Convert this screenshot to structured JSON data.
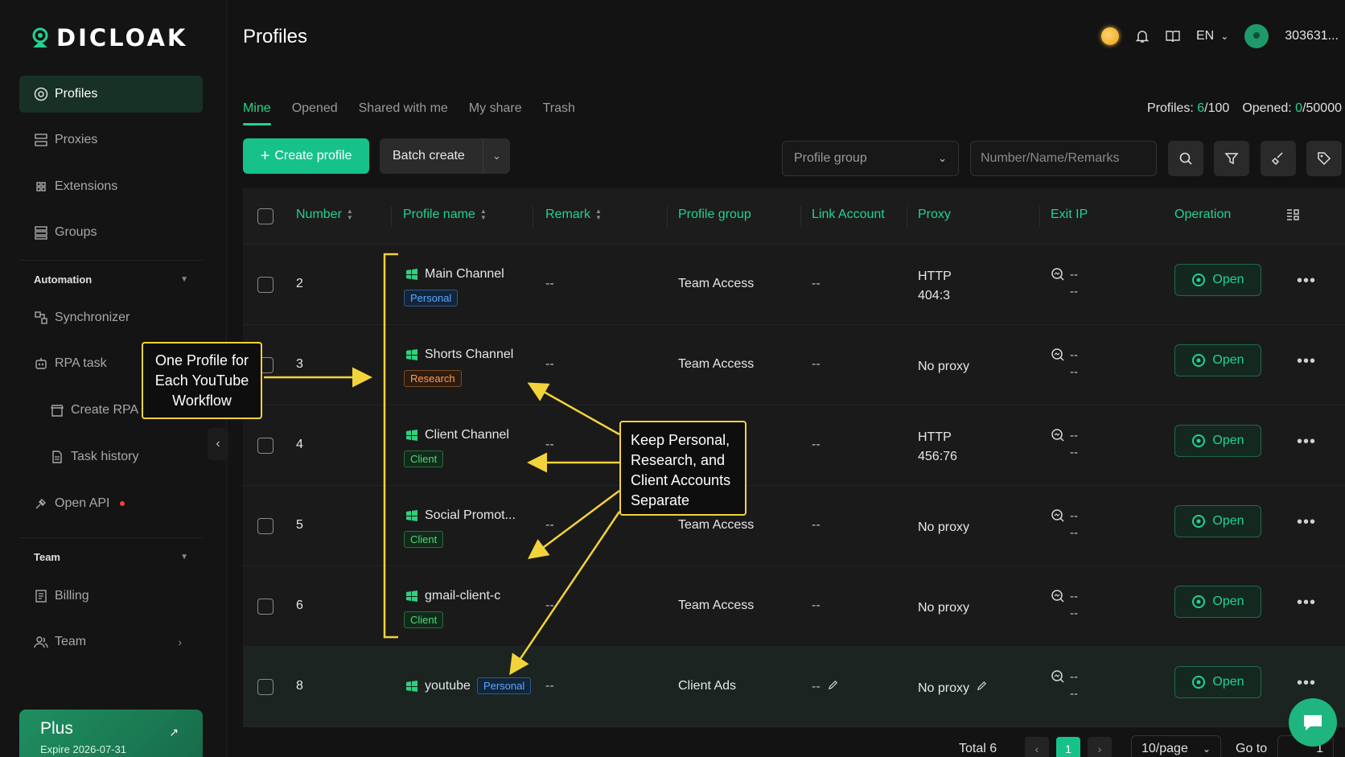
{
  "app": {
    "logo_text": "DICLOAK",
    "page_title": "Profiles",
    "language": "EN",
    "user_id": "303631..."
  },
  "sidebar": {
    "items": [
      {
        "label": "Profiles",
        "icon": "profiles-icon"
      },
      {
        "label": "Proxies",
        "icon": "proxies-icon"
      },
      {
        "label": "Extensions",
        "icon": "extensions-icon"
      },
      {
        "label": "Groups",
        "icon": "groups-icon"
      }
    ],
    "automation_label": "Automation",
    "automation_items": [
      {
        "label": "Synchronizer",
        "icon": "synchronizer-icon"
      },
      {
        "label": "RPA task",
        "icon": "robot-icon"
      },
      {
        "label": "Create RPA",
        "icon": "store-icon"
      },
      {
        "label": "Task history",
        "icon": "document-icon"
      },
      {
        "label": "Open API",
        "icon": "api-icon"
      }
    ],
    "team_label": "Team",
    "team_items": [
      {
        "label": "Billing",
        "icon": "billing-icon"
      },
      {
        "label": "Team",
        "icon": "team-icon"
      }
    ],
    "plan": {
      "name": "Plus",
      "expires": "Expire 2026-07-31"
    }
  },
  "tabs": [
    "Mine",
    "Opened",
    "Shared with me",
    "My share",
    "Trash"
  ],
  "counts": {
    "profiles_label": "Profiles:",
    "profiles_used": "6",
    "profiles_total": "/100",
    "opened_label": "Opened:",
    "opened_used": "0",
    "opened_total": "/50000"
  },
  "toolbar": {
    "create_label": "Create profile",
    "batch_label": "Batch create",
    "group_placeholder": "Profile group",
    "search_placeholder": "Number/Name/Remarks"
  },
  "table": {
    "headers": [
      "Number",
      "Profile name",
      "Remark",
      "Profile group",
      "Link Account",
      "Proxy",
      "Exit IP",
      "Operation"
    ],
    "open_label": "Open",
    "rows": [
      {
        "number": "2",
        "name": "Main Channel",
        "tag": "Personal",
        "tag_type": "personal",
        "remark": "--",
        "group": "Team Access",
        "link": "--",
        "proxy_1": "HTTP",
        "proxy_2": "404:3",
        "exit_1": "--",
        "exit_2": "--"
      },
      {
        "number": "3",
        "name": "Shorts Channel",
        "tag": "Research",
        "tag_type": "research",
        "remark": "--",
        "group": "Team Access",
        "link": "--",
        "proxy_1": "No proxy",
        "proxy_2": "",
        "exit_1": "--",
        "exit_2": "--"
      },
      {
        "number": "4",
        "name": "Client Channel",
        "tag": "Client",
        "tag_type": "client",
        "remark": "--",
        "group": "",
        "link": "--",
        "proxy_1": "HTTP",
        "proxy_2": "456:76",
        "exit_1": "--",
        "exit_2": "--"
      },
      {
        "number": "5",
        "name": "Social Promot...",
        "tag": "Client",
        "tag_type": "client",
        "remark": "--",
        "group": "Team Access",
        "link": "--",
        "proxy_1": "No proxy",
        "proxy_2": "",
        "exit_1": "--",
        "exit_2": "--"
      },
      {
        "number": "6",
        "name": "gmail-client-c",
        "tag": "Client",
        "tag_type": "client",
        "remark": "--",
        "group": "Team Access",
        "link": "--",
        "proxy_1": "No proxy",
        "proxy_2": "",
        "exit_1": "--",
        "exit_2": "--"
      },
      {
        "number": "8",
        "name": "youtube",
        "tag": "Personal",
        "tag_type": "personal",
        "remark": "--",
        "group": "Client Ads",
        "link": "--",
        "proxy_1": "No proxy",
        "proxy_2": "",
        "exit_1": "--",
        "exit_2": "--"
      }
    ]
  },
  "pagination": {
    "total": "Total 6",
    "current_page": "1",
    "page_size": "10/page",
    "goto_label": "Go to",
    "goto_value": "1"
  },
  "annotations": {
    "callout_1": [
      "One Profile for",
      "Each YouTube",
      "Workflow"
    ],
    "callout_2": [
      "Keep Personal,",
      "Research, and",
      "Client Accounts",
      "Separate"
    ]
  },
  "colors": {
    "accent": "#22d38f",
    "callout_border": "#f3d33b",
    "tag_personal": "#5aa8ff",
    "tag_research": "#ff9a55",
    "tag_client": "#4ed67a"
  }
}
